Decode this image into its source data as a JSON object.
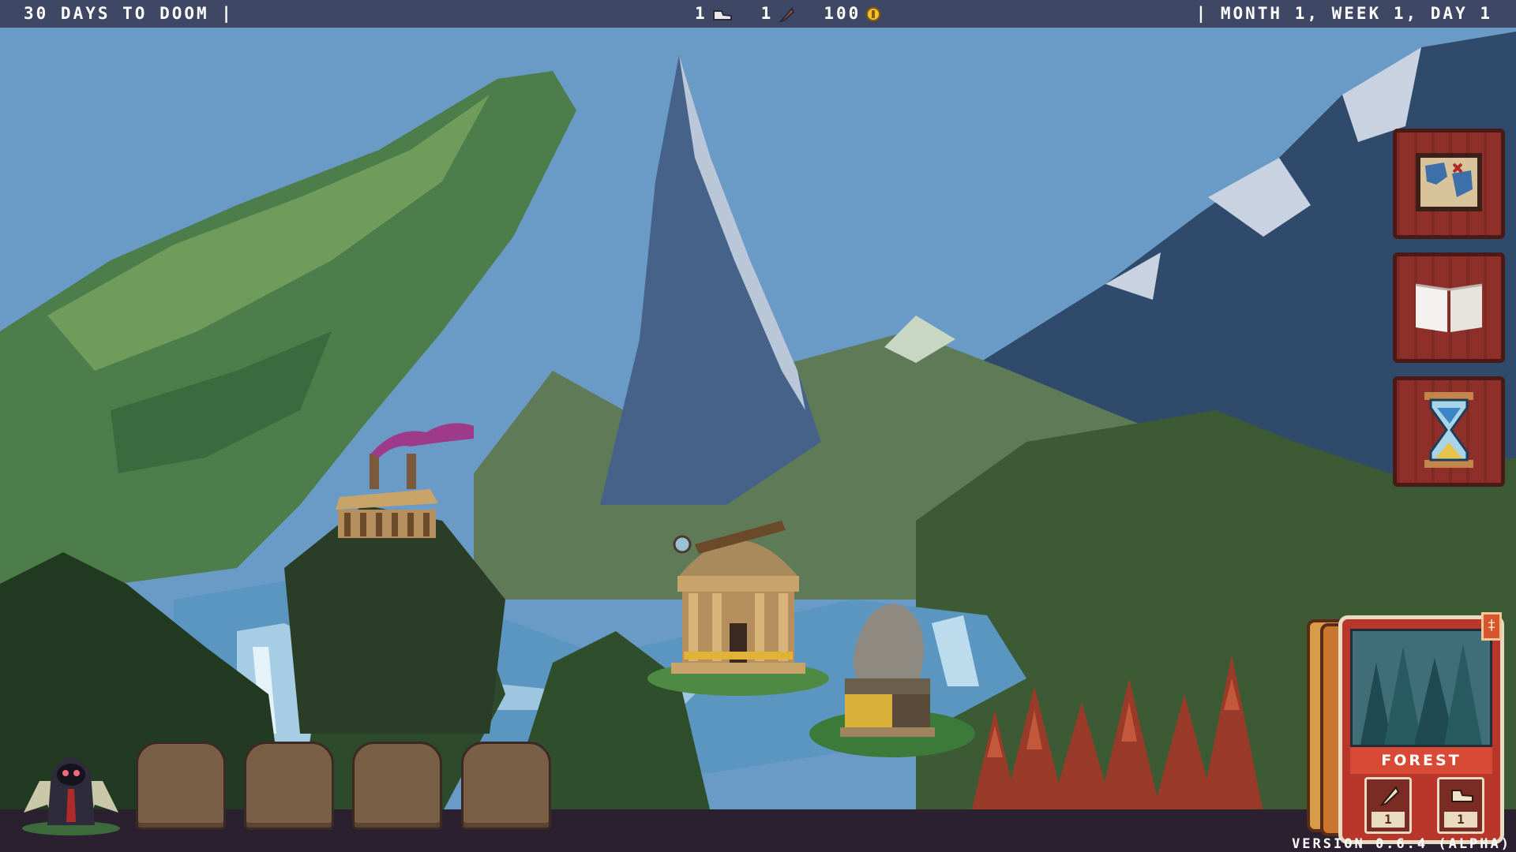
{
  "hud": {
    "countdown": "30 DAYS TO DOOM |",
    "date": "| MONTH 1, WEEK 1, DAY 1",
    "resources": [
      {
        "name": "resource-1",
        "value": "1",
        "icon": "shoe-icon"
      },
      {
        "name": "resource-2",
        "value": "1",
        "icon": "feather-icon"
      },
      {
        "name": "resource-3",
        "value": "100",
        "icon": "coin-icon"
      }
    ]
  },
  "actions": [
    {
      "name": "map-button",
      "icon": "map-icon"
    },
    {
      "name": "journal-button",
      "icon": "book-icon"
    },
    {
      "name": "end-day-button",
      "icon": "hourglass-icon"
    }
  ],
  "card": {
    "title": "FOREST",
    "stats": [
      {
        "icon": "feather-icon",
        "value": "1"
      },
      {
        "icon": "shoe-icon",
        "value": "1"
      }
    ]
  },
  "inventory_slots": 4,
  "version": "VERSION 0.6.4 (ALPHA)",
  "colors": {
    "hud_bg": "#3e4763",
    "sky": "#6a9bc6",
    "card_red": "#b9362b",
    "button_wood": "#8e2f2a"
  }
}
